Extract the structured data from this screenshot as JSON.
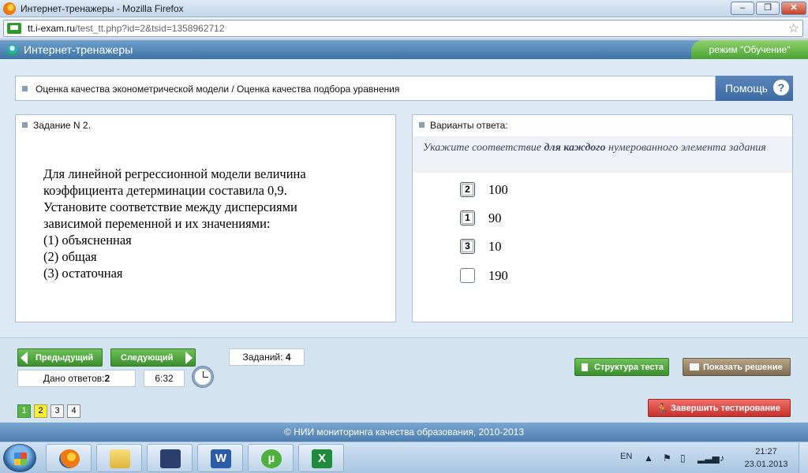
{
  "window": {
    "title": "Интернет-тренажеры - Mozilla Firefox",
    "min_label": "–",
    "max_label": "❐",
    "close_label": "✕"
  },
  "browser": {
    "url_domain": "tt.i-exam.ru",
    "url_path": "/test_tt.php?id=2&tsid=1358962712",
    "bookmark_icon": "star-icon"
  },
  "app": {
    "title": "Интернет-тренажеры",
    "mode": "режим \"Обучение\""
  },
  "breadcrumb": "Оценка качества эконометрической модели / Оценка качества подбора уравнения",
  "help_label": "Помощь",
  "help_icon_glyph": "?",
  "task": {
    "header": "Задание N 2.",
    "lines": [
      "Для линейной регрессионной модели величина",
      "коэффициента детерминации составила 0,9.",
      "Установите соответствие между дисперсиями",
      "зависимой переменной и их значениями:",
      "(1) объясненная",
      "(2) общая",
      "(3) остаточная"
    ]
  },
  "answers": {
    "header": "Варианты ответа:",
    "instruction_before": "Укажите соответствие ",
    "instruction_bold": "для каждого",
    "instruction_after": " нумерованного элемента задания",
    "options": [
      {
        "mark": "2",
        "value": "100"
      },
      {
        "mark": "1",
        "value": "90"
      },
      {
        "mark": "3",
        "value": "10"
      },
      {
        "mark": "",
        "value": "190"
      }
    ]
  },
  "controls": {
    "prev_label": "Предыдущий",
    "next_label": "Следующий",
    "answered_label": "Дано ответов:",
    "answered_count": "2",
    "timer": "6:32",
    "tasks_label": "Заданий:",
    "tasks_count": "4",
    "pages": [
      "1",
      "2",
      "3",
      "4"
    ],
    "structure_label": "Структура теста",
    "solution_label": "Показать решение",
    "finish_label": "Завершить тестирование"
  },
  "footer": "© НИИ мониторинга качества образования, 2010-2013",
  "taskbar": {
    "apps": [
      "firefox-icon",
      "folder-icon",
      "save-icon",
      "word-icon",
      "utorrent-icon",
      "excel-icon"
    ],
    "word_glyph": "W",
    "utorrent_glyph": "µ",
    "excel_glyph": "X",
    "lang": "EN",
    "time": "21:27",
    "date": "23.01.2013"
  },
  "colors": {
    "accent_blue": "#3c6aa3",
    "green_button": "#4aa336",
    "finish_red": "#c8312d",
    "current_page": "#f6ee3a",
    "done_page": "#58b448"
  }
}
